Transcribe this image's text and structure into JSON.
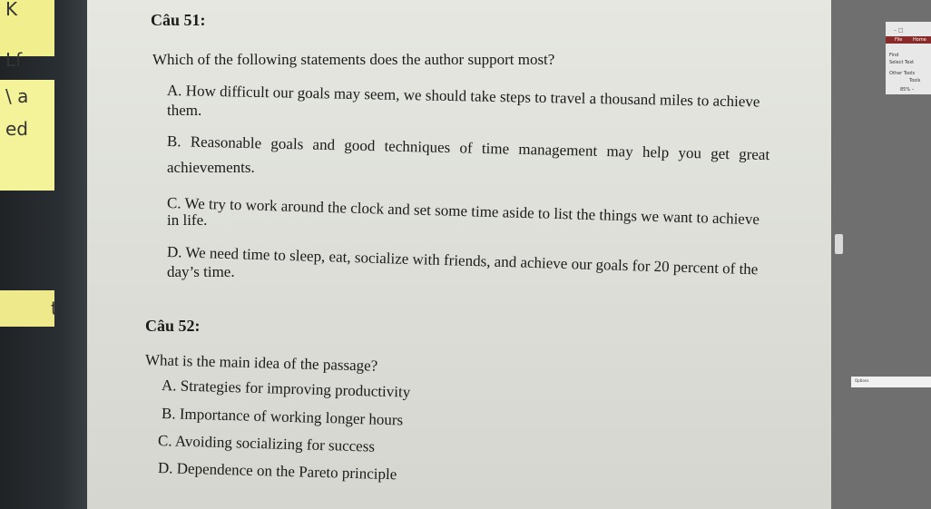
{
  "left_notes": [
    "K",
    "Lf",
    "\\ a",
    "ed",
    "t"
  ],
  "right_app": {
    "controls": "– □",
    "tab_file": "File",
    "tab_home": "Home",
    "find": "Find",
    "select_text": "Select Text",
    "other_tools": "Other Tools",
    "tools": "Tools",
    "zoom": "85% –",
    "status": "Options"
  },
  "questions": [
    {
      "label": "Câu 51:",
      "prompt": "Which of the following statements does the author support most?",
      "options": [
        {
          "line1": "A. How difficult our goals may seem, we should take steps to travel a thousand miles to achieve",
          "line2": "them."
        },
        {
          "line1": "B. Reasonable goals and good techniques of time management may help you get great",
          "line2": "achievements."
        },
        {
          "line1": "C. We try to work around the clock and set some time aside to list the things we want to achieve",
          "line2": "in life."
        },
        {
          "line1": "D. We need time to sleep, eat, socialize with friends, and achieve our goals for 20 percent of the",
          "line2": "day’s time."
        }
      ]
    },
    {
      "label": "Câu 52:",
      "prompt": "What is the main idea of the passage?",
      "options": [
        {
          "line1": "A. Strategies for improving productivity"
        },
        {
          "line1": "B. Importance of working longer hours"
        },
        {
          "line1": "C. Avoiding socializing for success"
        },
        {
          "line1": "D. Dependence on the Pareto principle"
        }
      ]
    }
  ]
}
